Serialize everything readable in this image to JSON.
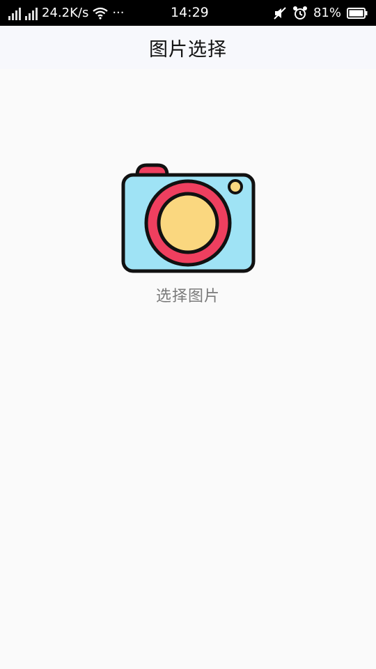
{
  "status_bar": {
    "network_speed": "24.2K/s",
    "more": "···",
    "time": "14:29",
    "battery": "81%"
  },
  "header": {
    "title": "图片选择"
  },
  "picker": {
    "label": "选择图片",
    "icon": "camera-icon"
  },
  "colors": {
    "status_bar_bg": "#000000",
    "header_bg": "#f7f8fc",
    "page_bg": "#fafafa",
    "camera_body": "#9fe3f5",
    "camera_ring": "#ef3f5f",
    "camera_lens": "#fad77f"
  }
}
